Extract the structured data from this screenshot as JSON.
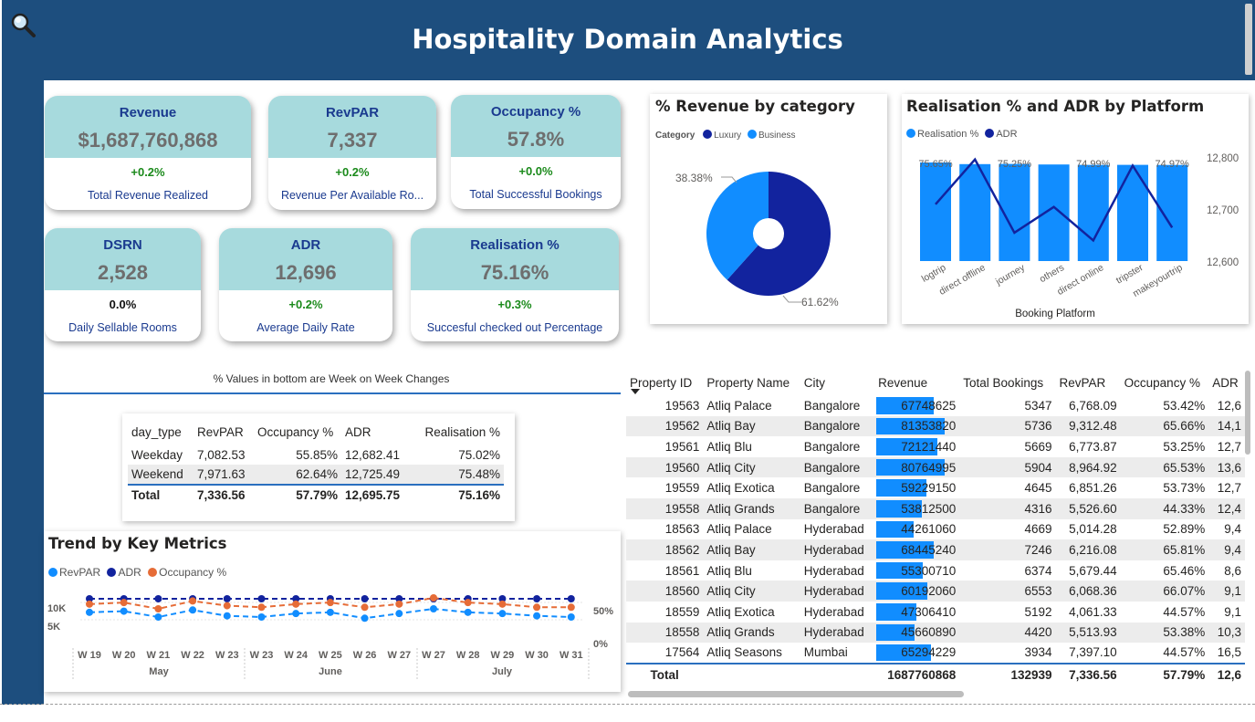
{
  "header": {
    "title": "Hospitality Domain Analytics",
    "icon": "search-icon"
  },
  "kpis": [
    {
      "name": "Revenue",
      "value": "$1,687,760,868",
      "change": "+0.2%",
      "desc": "Total Revenue Realized"
    },
    {
      "name": "RevPAR",
      "value": "7,337",
      "change": "+0.2%",
      "desc": "Revenue Per Available Ro..."
    },
    {
      "name": "Occupancy %",
      "value": "57.8%",
      "change": "+0.0%",
      "desc": "Total Successful Bookings"
    },
    {
      "name": "DSRN",
      "value": "2,528",
      "change": "0.0%",
      "desc": "Daily Sellable Rooms"
    },
    {
      "name": "ADR",
      "value": "12,696",
      "change": "+0.2%",
      "desc": "Average Daily Rate"
    },
    {
      "name": "Realisation %",
      "value": "75.16%",
      "change": "+0.3%",
      "desc": "Succesful checked out Percentage"
    }
  ],
  "note": "% Values in bottom are Week on Week Changes",
  "daytype": {
    "headers": [
      "day_type",
      "RevPAR",
      "Occupancy %",
      "ADR",
      "Realisation %"
    ],
    "rows": [
      [
        "Weekday",
        "7,082.53",
        "55.85%",
        "12,682.41",
        "75.02%"
      ],
      [
        "Weekend",
        "7,971.63",
        "62.64%",
        "12,725.49",
        "75.48%"
      ]
    ],
    "total": [
      "Total",
      "7,336.56",
      "57.79%",
      "12,695.75",
      "75.16%"
    ]
  },
  "pie": {
    "title": "% Revenue by category",
    "legend_title": "Category",
    "labels": [
      "38.38%",
      "61.62%"
    ],
    "colors": {
      "luxury": "#12239e",
      "business": "#118dff"
    },
    "chart_data": {
      "type": "pie",
      "categories": [
        "Luxury",
        "Business"
      ],
      "values": [
        61.62,
        38.38
      ]
    }
  },
  "platform": {
    "title": "Realisation % and ADR by Platform",
    "xlabel": "Booking Platform",
    "legend": [
      "Realisation %",
      "ADR"
    ],
    "bar_labels": [
      "75.65%",
      "75.25%",
      "74.99%",
      "74.97%"
    ],
    "yticks": [
      "12,800",
      "12,700",
      "12,600"
    ],
    "chart_data": {
      "type": "bar",
      "categories": [
        "logtrip",
        "direct offline",
        "journey",
        "others",
        "direct online",
        "tripster",
        "makeyourtrip"
      ],
      "series": [
        {
          "name": "Realisation %",
          "values": [
            75.65,
            75.2,
            75.25,
            75.1,
            74.99,
            75.0,
            74.97
          ]
        },
        {
          "name": "ADR",
          "values": [
            12710,
            12797,
            12655,
            12705,
            12640,
            12785,
            12665
          ]
        }
      ],
      "ylim": [
        12600,
        12800
      ]
    }
  },
  "trend": {
    "title": "Trend by Key Metrics",
    "legend": [
      "RevPAR",
      "ADR",
      "Occupancy %"
    ],
    "yleft": [
      "10K",
      "5K"
    ],
    "yright": [
      "50%",
      "0%"
    ],
    "months": [
      "May",
      "June",
      "July"
    ],
    "chart_data": {
      "type": "line",
      "x": [
        "W 19",
        "W 20",
        "W 21",
        "W 22",
        "W 23",
        "W 23",
        "W 24",
        "W 25",
        "W 26",
        "W 27",
        "W 27",
        "W 28",
        "W 29",
        "W 30",
        "W 31"
      ],
      "series": [
        {
          "name": "RevPAR",
          "values": [
            7300,
            7400,
            6900,
            7500,
            7000,
            6900,
            7200,
            7300,
            6800,
            7200,
            7600,
            7300,
            7200,
            7000,
            6900
          ]
        },
        {
          "name": "ADR",
          "values": [
            12700,
            12700,
            12700,
            12700,
            12700,
            12700,
            12700,
            12700,
            12700,
            12700,
            12700,
            12700,
            12700,
            12700,
            12700
          ]
        },
        {
          "name": "Occupancy %",
          "values": [
            58,
            59,
            55,
            60,
            57,
            56,
            58,
            59,
            56,
            58,
            62,
            59,
            58,
            56,
            56
          ]
        }
      ]
    }
  },
  "properties": {
    "headers": [
      "Property ID",
      "Property Name",
      "City",
      "Revenue",
      "Total Bookings",
      "RevPAR",
      "Occupancy %",
      "ADR"
    ],
    "rows": [
      [
        "19563",
        "Atliq Palace",
        "Bangalore",
        "67748625",
        "5347",
        "6,768.09",
        "53.42%",
        "12,6"
      ],
      [
        "19562",
        "Atliq Bay",
        "Bangalore",
        "81353820",
        "5736",
        "9,312.48",
        "65.66%",
        "14,1"
      ],
      [
        "19561",
        "Atliq Blu",
        "Bangalore",
        "72121440",
        "5669",
        "6,773.87",
        "53.25%",
        "12,7"
      ],
      [
        "19560",
        "Atliq City",
        "Bangalore",
        "80764995",
        "5904",
        "8,964.92",
        "65.53%",
        "13,6"
      ],
      [
        "19559",
        "Atliq Exotica",
        "Bangalore",
        "59229150",
        "4645",
        "6,851.26",
        "53.73%",
        "12,7"
      ],
      [
        "19558",
        "Atliq Grands",
        "Bangalore",
        "53812500",
        "4316",
        "5,526.60",
        "44.33%",
        "12,4"
      ],
      [
        "18563",
        "Atliq Palace",
        "Hyderabad",
        "44261060",
        "4669",
        "5,014.28",
        "52.89%",
        "9,4"
      ],
      [
        "18562",
        "Atliq Bay",
        "Hyderabad",
        "68445240",
        "7246",
        "6,216.08",
        "65.81%",
        "9,4"
      ],
      [
        "18561",
        "Atliq Blu",
        "Hyderabad",
        "55300710",
        "6374",
        "5,679.44",
        "65.46%",
        "8,6"
      ],
      [
        "18560",
        "Atliq City",
        "Hyderabad",
        "60192060",
        "6553",
        "6,068.36",
        "66.07%",
        "9,1"
      ],
      [
        "18559",
        "Atliq Exotica",
        "Hyderabad",
        "47306410",
        "5192",
        "4,061.33",
        "44.57%",
        "9,1"
      ],
      [
        "18558",
        "Atliq Grands",
        "Hyderabad",
        "45660890",
        "4420",
        "5,513.93",
        "53.38%",
        "10,3"
      ],
      [
        "17564",
        "Atliq Seasons",
        "Mumbai",
        "65294229",
        "3934",
        "7,397.10",
        "44.57%",
        "16,5"
      ]
    ],
    "total": [
      "Total",
      "",
      "",
      "1687760868",
      "132939",
      "7,336.56",
      "57.79%",
      "12,6"
    ],
    "revenue_max": 81353820
  }
}
